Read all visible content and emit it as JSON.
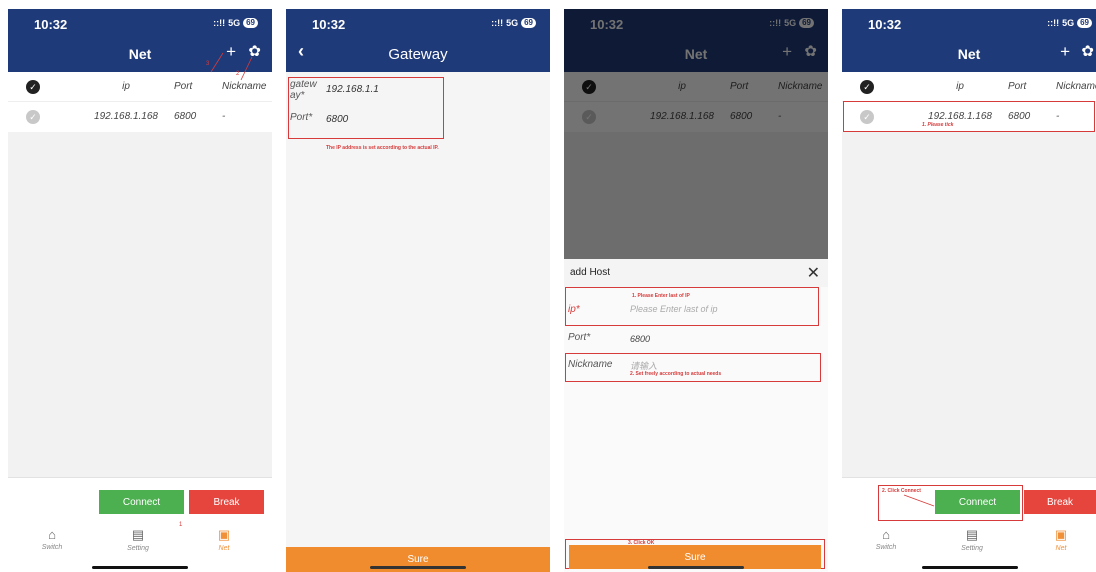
{
  "status": {
    "time": "10:32",
    "signal": "::!!",
    "network": "5G",
    "battery": "69"
  },
  "net_list": {
    "title": "Net",
    "plus_icon": "plus-icon",
    "gear_icon": "gear-icon",
    "columns": {
      "ip": "ip",
      "port": "Port",
      "nickname": "Nickname"
    },
    "rows": [
      {
        "ip": "192.168.1.168",
        "port": "6800",
        "nickname": "-"
      }
    ]
  },
  "buttons": {
    "connect": "Connect",
    "break": "Break"
  },
  "tabs": [
    {
      "label": "Switch",
      "icon": "home-icon"
    },
    {
      "label": "Setting",
      "icon": "store-icon"
    },
    {
      "label": "Net",
      "icon": "clipboard-icon"
    }
  ],
  "annotations_p1": {
    "n1": "1",
    "n2": "2",
    "n3": "3"
  },
  "gateway": {
    "title": "Gateway",
    "gateway_label": "gatew ay*",
    "gateway_value": "192.168.1.1",
    "port_label": "Port*",
    "port_value": "6800",
    "note": "The IP address is set according to the actual IP.",
    "sure": "Sure"
  },
  "add_host": {
    "title": "add Host",
    "ip_label": "ip*",
    "ip_placeholder": "Please Enter last of ip",
    "port_label": "Port*",
    "port_value": "6800",
    "nickname_label": "Nickname",
    "nickname_placeholder": "请输入",
    "note1": "1. Please Enter last of IP",
    "note2": "2. Set freely according to actual needs",
    "note3": "3. Click OK",
    "sure": "Sure"
  },
  "panel4": {
    "note_tick": "1. Please tick",
    "note_connect": "2. Click Connect"
  }
}
